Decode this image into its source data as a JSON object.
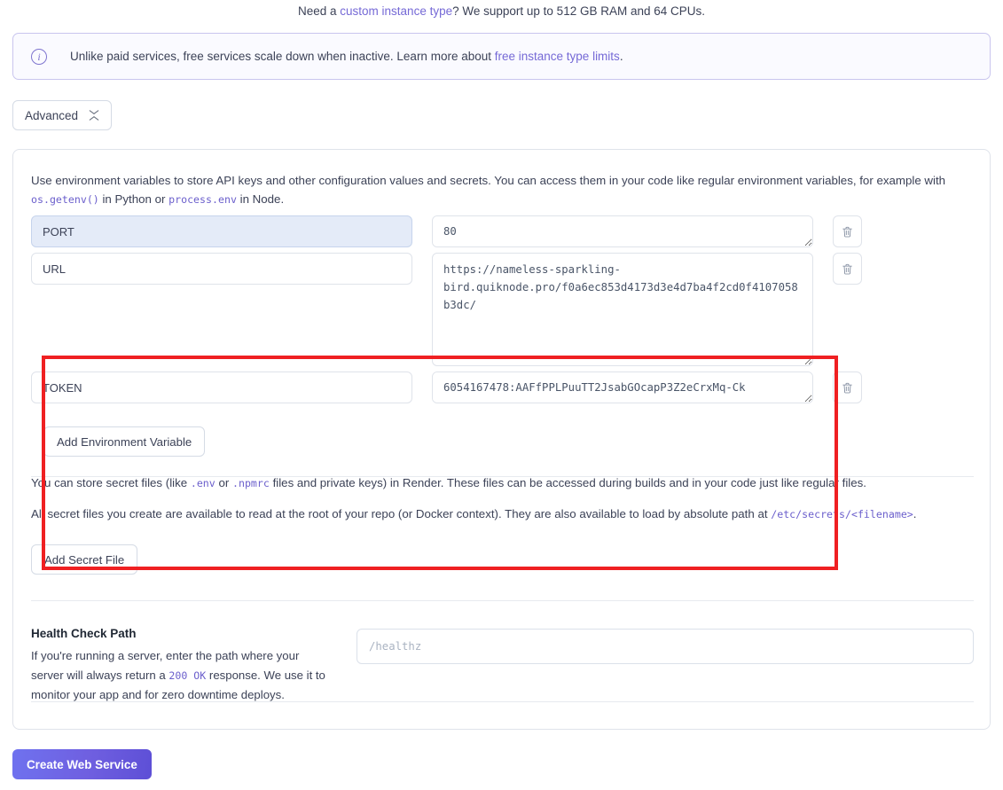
{
  "top_note": {
    "prefix": "Need a ",
    "link": "custom instance type",
    "suffix": "? We support up to 512 GB RAM and 64 CPUs."
  },
  "banner": {
    "icon": "info-circle-icon",
    "prefix": "Unlike paid services, free services scale down when inactive. Learn more about ",
    "link": "free instance type limits",
    "suffix": ".",
    "border_color": "#c9c5ee",
    "background_color": "#fafaff"
  },
  "advanced": {
    "label": "Advanced",
    "icon": "collapse-icon"
  },
  "env_section": {
    "description_part1": "Use environment variables to store API keys and other configuration values and secrets. You can access them in your code like regular environment variables, for example with ",
    "code_getenv": "os.getenv()",
    "description_part2": " in Python or ",
    "code_processenv": "process.env",
    "description_part3": " in Node.",
    "key_placeholder": "",
    "rows": [
      {
        "key": "PORT",
        "value": "80",
        "selected": true,
        "tall": false,
        "delete_icon": "trash-icon"
      },
      {
        "key": "URL",
        "value": "https://nameless-sparkling-bird.quiknode.pro/f0a6ec853d4173d3e4d7ba4f2cd0f4107058b3dc/",
        "selected": false,
        "tall": true,
        "delete_icon": "trash-icon"
      },
      {
        "key": "TOKEN",
        "value": "6054167478:AAFfPPLPuuTT2JsabGOcapP3Z2eCrxMq-Ck",
        "selected": false,
        "tall": false,
        "delete_icon": "trash-icon"
      }
    ],
    "add_button": "Add Environment Variable",
    "highlight_color": "#ef2022"
  },
  "secret_files": {
    "line1_a": "You can store secret files (like ",
    "line1_code1": ".env",
    "line1_b": " or ",
    "line1_code2": ".npmrc",
    "line1_c": " files and private keys) in Render. These files can be accessed during builds and in your code just like regular files.",
    "line2_a": "All secret files you create are available to read at the root of your repo (or Docker context). They are also available to load by absolute path at ",
    "line2_code": "/etc/secrets/<filename>",
    "line2_b": ".",
    "add_button": "Add Secret File"
  },
  "health_check": {
    "title": "Health Check Path",
    "desc_a": "If you're running a server, enter the path where your server will always return a ",
    "desc_code": "200 OK",
    "desc_b": " response. We use it to monitor your app and for zero downtime deploys.",
    "placeholder": "/healthz",
    "value": ""
  },
  "submit": {
    "label": "Create Web Service",
    "color": "#6f5fe0"
  }
}
